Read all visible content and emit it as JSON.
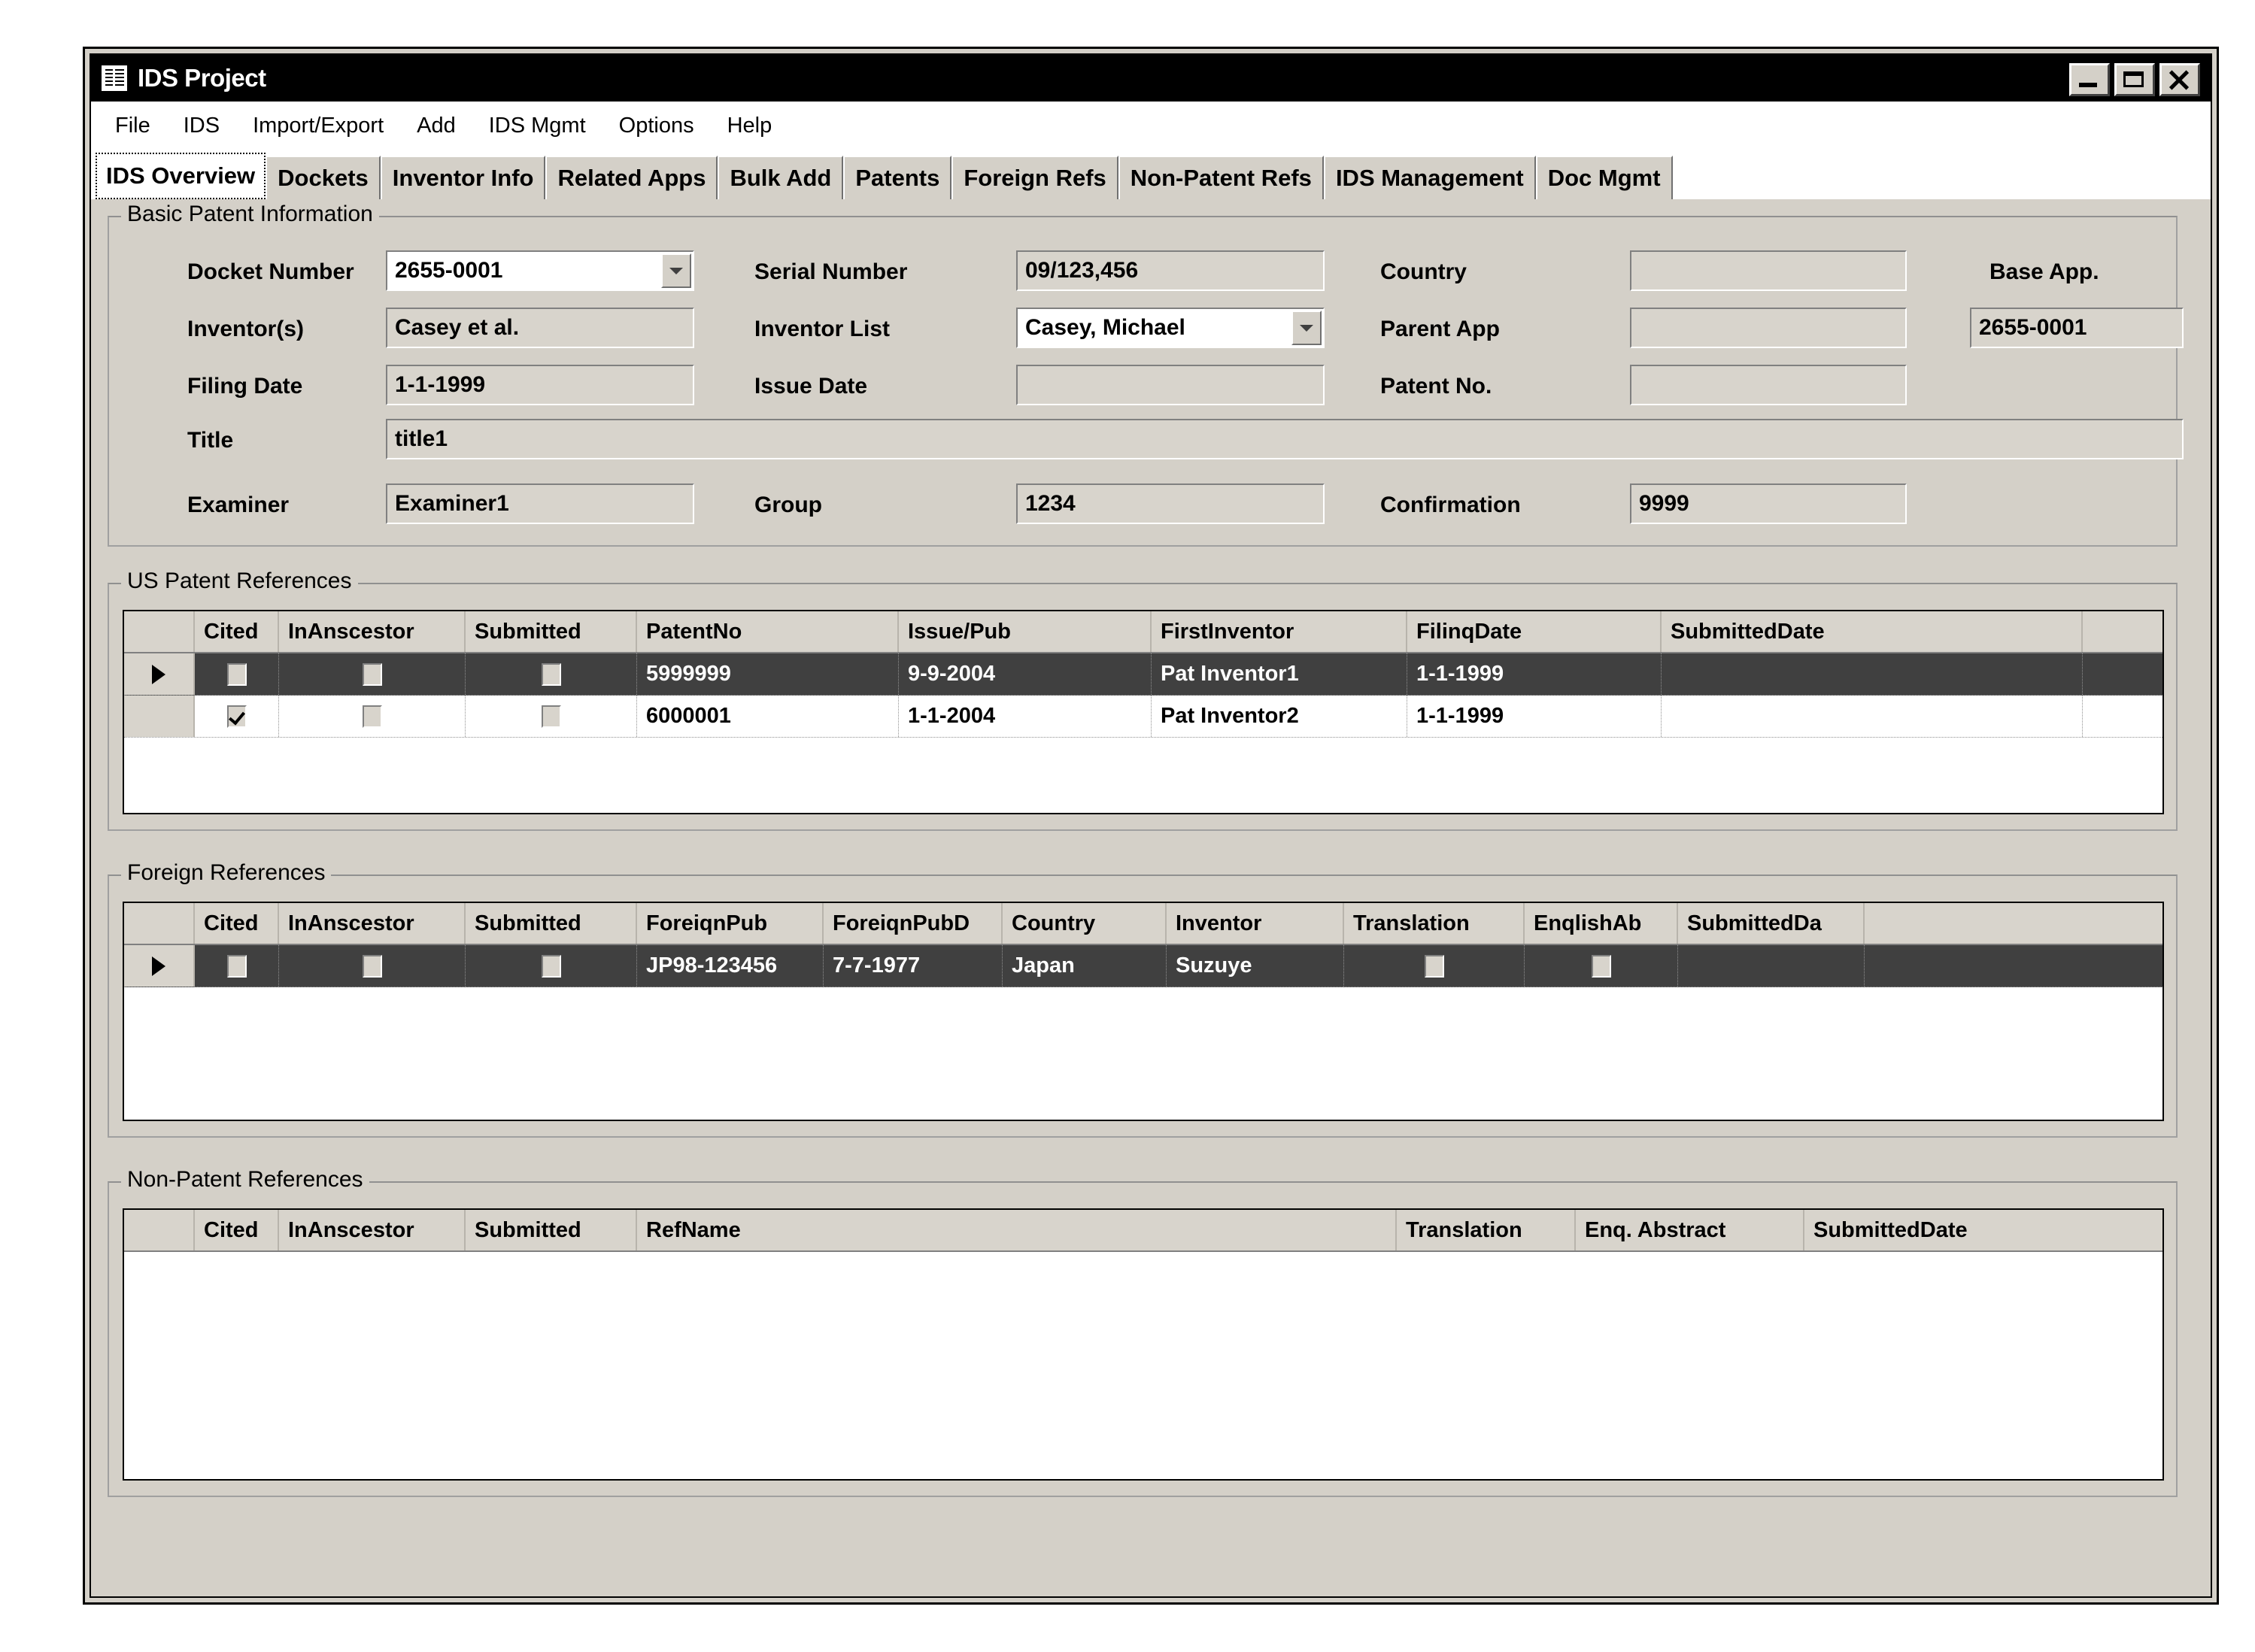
{
  "window": {
    "title": "IDS Project",
    "icon": "app-icon",
    "buttons": {
      "minimize": "minimize",
      "maximize": "maximize",
      "close": "close"
    }
  },
  "menu": [
    "File",
    "IDS",
    "Import/Export",
    "Add",
    "IDS Mgmt",
    "Options",
    "Help"
  ],
  "tabs": [
    {
      "label": "IDS Overview",
      "selected": true
    },
    {
      "label": "Dockets",
      "selected": false
    },
    {
      "label": "Inventor Info",
      "selected": false
    },
    {
      "label": "Related Apps",
      "selected": false
    },
    {
      "label": "Bulk Add",
      "selected": false
    },
    {
      "label": "Patents",
      "selected": false
    },
    {
      "label": "Foreign Refs",
      "selected": false
    },
    {
      "label": "Non-Patent Refs",
      "selected": false
    },
    {
      "label": "IDS Management",
      "selected": false
    },
    {
      "label": "Doc Mgmt",
      "selected": false
    }
  ],
  "basic_info": {
    "legend": "Basic Patent Information",
    "labels": {
      "docket_number": "Docket Number",
      "serial_number": "Serial Number",
      "country": "Country",
      "base_app": "Base App.",
      "inventors": "Inventor(s)",
      "inventor_list": "Inventor List",
      "parent_app": "Parent App",
      "filing_date": "Filing Date",
      "issue_date": "Issue Date",
      "patent_no": "Patent No.",
      "title": "Title",
      "examiner": "Examiner",
      "group": "Group",
      "confirmation": "Confirmation"
    },
    "values": {
      "docket_number": "2655-0001",
      "serial_number": "09/123,456",
      "country": "",
      "base_app": "2655-0001",
      "inventors": "Casey et al.",
      "inventor_list": "Casey, Michael",
      "parent_app": "",
      "filing_date": "1-1-1999",
      "issue_date": "",
      "patent_no": "",
      "title": "title1",
      "examiner": "Examiner1",
      "group": "1234",
      "confirmation": "9999"
    }
  },
  "us_patent_references": {
    "legend": "US Patent References",
    "columns": [
      "Cited",
      "InAnscestor",
      "Submitted",
      "PatentNo",
      "Issue/Pub",
      "FirstInventor",
      "FilinqDate",
      "SubmittedDate"
    ],
    "rows": [
      {
        "selected": true,
        "current": true,
        "Cited": false,
        "InAnscestor": false,
        "Submitted": false,
        "PatentNo": "5999999",
        "Issue/Pub": "9-9-2004",
        "FirstInventor": "Pat Inventor1",
        "FilinqDate": "1-1-1999",
        "SubmittedDate": ""
      },
      {
        "selected": false,
        "current": false,
        "Cited": true,
        "InAnscestor": false,
        "Submitted": false,
        "PatentNo": "6000001",
        "Issue/Pub": "1-1-2004",
        "FirstInventor": "Pat Inventor2",
        "FilinqDate": "1-1-1999",
        "SubmittedDate": ""
      }
    ]
  },
  "foreign_references": {
    "legend": "Foreign References",
    "columns": [
      "Cited",
      "InAnscestor",
      "Submitted",
      "ForeiqnPub",
      "ForeiqnPubD",
      "Country",
      "Inventor",
      "Translation",
      "EnqlishAb",
      "SubmittedDa"
    ],
    "rows": [
      {
        "selected": true,
        "current": true,
        "Cited": false,
        "InAnscestor": false,
        "Submitted": false,
        "ForeiqnPub": "JP98-123456",
        "ForeiqnPubD": "7-7-1977",
        "Country": "Japan",
        "Inventor": "Suzuye",
        "Translation": false,
        "EnqlishAb": false,
        "SubmittedDa": ""
      }
    ]
  },
  "non_patent_references": {
    "legend": "Non-Patent References",
    "columns": [
      "Cited",
      "InAnscestor",
      "Submitted",
      "RefName",
      "Translation",
      "Enq. Abstract",
      "SubmittedDate"
    ],
    "rows": []
  },
  "colors": {
    "window_face": "#d4d0c8",
    "field_face": "#d8d4cc",
    "selection": "#404040",
    "titlebar": "#000000"
  }
}
